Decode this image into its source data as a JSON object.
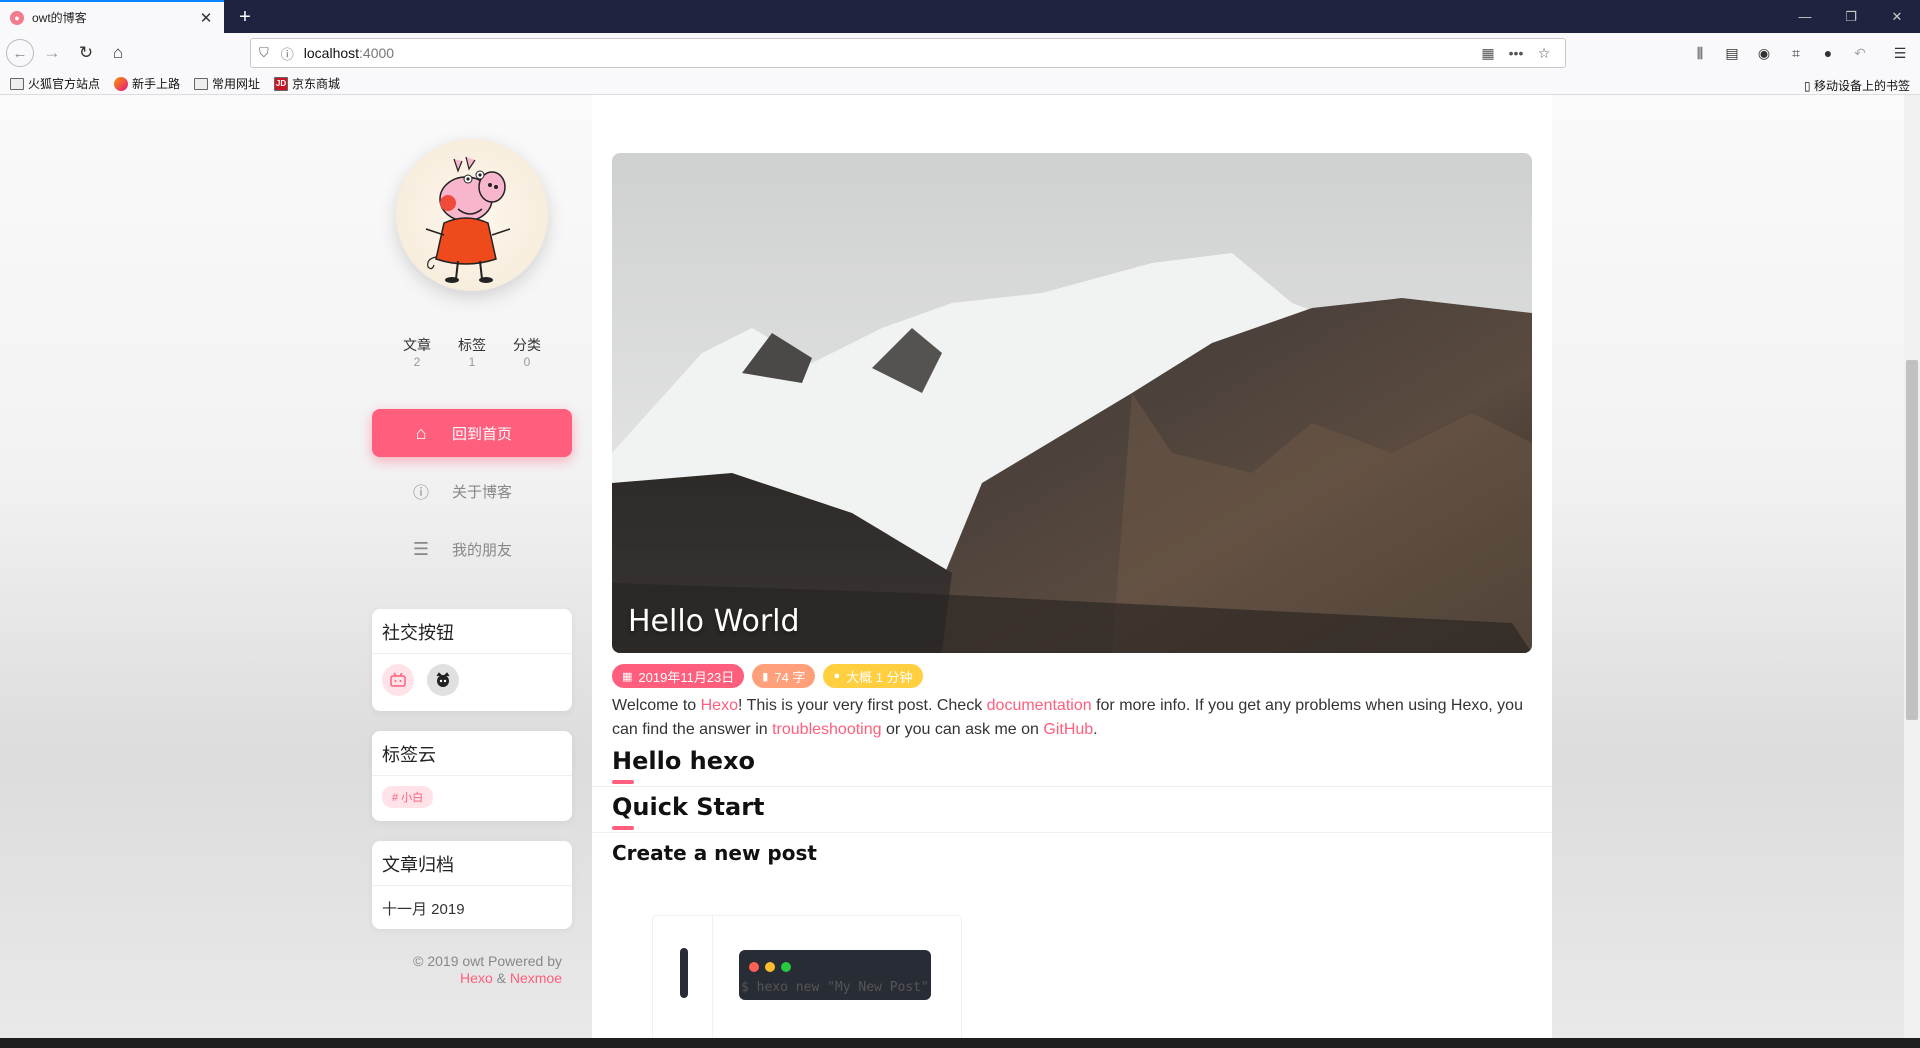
{
  "browser": {
    "tab_title": "owt的博客",
    "url_host": "localhost",
    "url_port": ":4000",
    "bookmarks": [
      "火狐官方站点",
      "新手上路",
      "常用网址",
      "京东商城"
    ],
    "mobile_bookmarks": "移动设备上的书签"
  },
  "sidebar": {
    "stats": [
      {
        "label": "文章",
        "value": "2"
      },
      {
        "label": "标签",
        "value": "1"
      },
      {
        "label": "分类",
        "value": "0"
      }
    ],
    "menu": [
      {
        "label": "回到首页",
        "icon": "home-icon",
        "active": true
      },
      {
        "label": "关于博客",
        "icon": "info-icon",
        "active": false
      },
      {
        "label": "我的朋友",
        "icon": "list-icon",
        "active": false
      }
    ],
    "social_title": "社交按钮",
    "social_buttons": [
      "bilibili-icon",
      "github-icon"
    ],
    "tagcloud_title": "标签云",
    "tags": [
      "# 小白"
    ],
    "archive_title": "文章归档",
    "archive_items": [
      "十一月 2019"
    ],
    "copyright": "© 2019 owt Powered by",
    "powered_hexo": "Hexo",
    "powered_amp": "&",
    "powered_theme": "Nexmoe"
  },
  "post": {
    "title": "Hello World",
    "date": "2019年11月23日",
    "words": "74 字",
    "read_time": "大概 1 分钟",
    "intro": {
      "t1": "Welcome to ",
      "link1": "Hexo",
      "t2": "! This is your very first post. Check ",
      "link2": "documentation",
      "t3": " for more info. If you get any problems when using Hexo, you can find the answer in ",
      "link3": "troubleshooting",
      "t4": " or you can ask me on ",
      "link4": "GitHub",
      "t5": "."
    },
    "h_hello": "Hello hexo",
    "h_quick": "Quick Start",
    "h_create": "Create a new post",
    "code": "$ hexo new \"My New Post\""
  },
  "colors": {
    "accent": "#ff5e7c",
    "date_badge": "#ff5e7c",
    "words_badge": "#ffa07a",
    "time_badge": "#ffcf40"
  }
}
